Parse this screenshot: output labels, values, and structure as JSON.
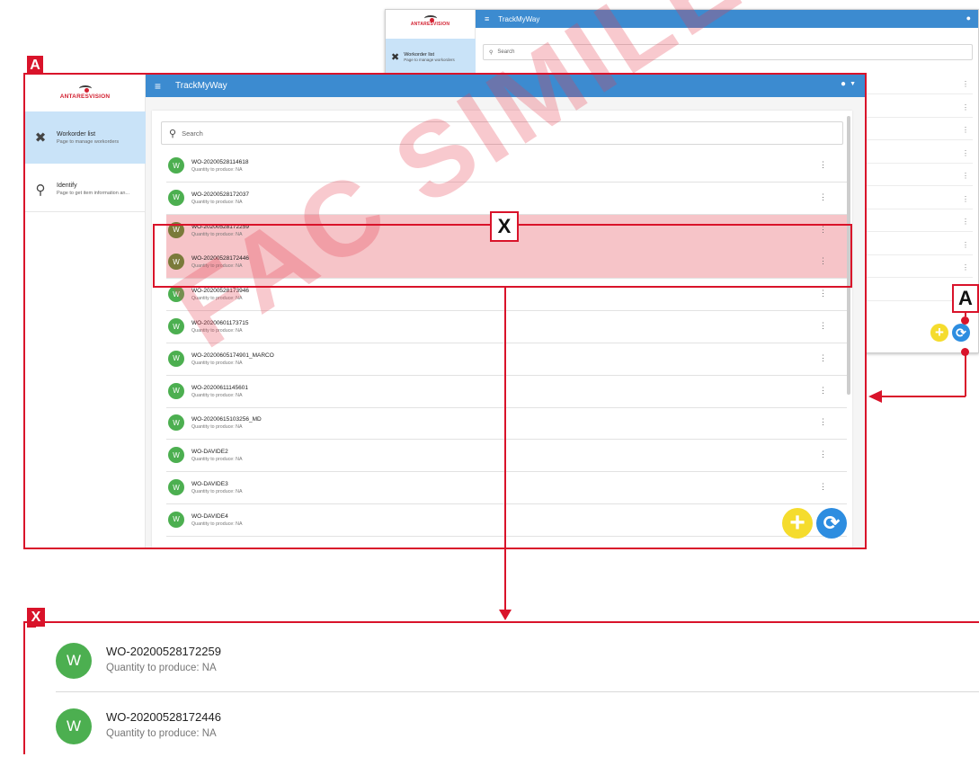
{
  "app": {
    "title": "TrackMyWay",
    "logo_text": "ANTARESVISION"
  },
  "sidebar": {
    "items": [
      {
        "title": "Workorder list",
        "subtitle": "Page to manage workorders",
        "icon": "wrench-screwdriver-icon",
        "active": true
      },
      {
        "title": "Identify",
        "subtitle": "Page to get item information an...",
        "icon": "search-icon",
        "active": false
      }
    ]
  },
  "search": {
    "placeholder": "Search"
  },
  "workorders": [
    {
      "code": "WO-20200528114618",
      "qty": "Quantity to produce: NA",
      "avatar": "W"
    },
    {
      "code": "WO-20200528172037",
      "qty": "Quantity to produce: NA",
      "avatar": "W"
    },
    {
      "code": "WO-20200528172259",
      "qty": "Quantity to produce: NA",
      "avatar": "W"
    },
    {
      "code": "WO-20200528172446",
      "qty": "Quantity to produce: NA",
      "avatar": "W"
    },
    {
      "code": "WO-20200528173946",
      "qty": "Quantity to produce: NA",
      "avatar": "W"
    },
    {
      "code": "WO-20200601173715",
      "qty": "Quantity to produce: NA",
      "avatar": "W"
    },
    {
      "code": "WO-20200605174901_MARCO",
      "qty": "Quantity to produce: NA",
      "avatar": "W"
    },
    {
      "code": "WO-20200611145601",
      "qty": "Quantity to produce: NA",
      "avatar": "W"
    },
    {
      "code": "WO-20200615103256_MD",
      "qty": "Quantity to produce: NA",
      "avatar": "W"
    },
    {
      "code": "WO-DAVIDE2",
      "qty": "Quantity to produce: NA",
      "avatar": "W"
    },
    {
      "code": "WO-DAVIDE3",
      "qty": "Quantity to produce: NA",
      "avatar": "W"
    },
    {
      "code": "WO-DAVIDE4",
      "qty": "Quantity to produce: NA",
      "avatar": "W"
    }
  ],
  "callouts": {
    "a": "A",
    "x": "X"
  },
  "watermark": "FAC SIMILE",
  "detail": [
    {
      "code": "WO-20200528172259",
      "qty": "Quantity to produce: NA",
      "avatar": "W"
    },
    {
      "code": "WO-20200528172446",
      "qty": "Quantity to produce: NA",
      "avatar": "W"
    }
  ],
  "colors": {
    "topbar": "#3c8bd0",
    "annotation": "#d9132a",
    "fab_add": "#f5dc2d",
    "fab_refresh": "#2d8de0",
    "avatar": "#4caf50"
  }
}
